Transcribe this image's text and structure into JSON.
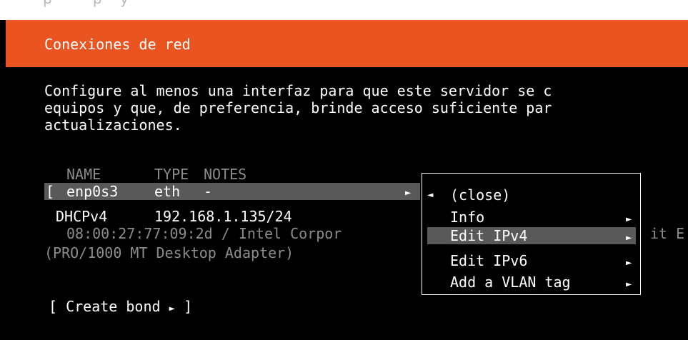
{
  "header": {
    "title": "Conexiones de red"
  },
  "description": {
    "line1": "Configure al menos una interfaz para que este servidor se c",
    "line2": "equipos y que, de preferencia, brinde acceso suficiente par",
    "line3": "actualizaciones."
  },
  "table": {
    "columns": [
      "NAME",
      "TYPE",
      "NOTES"
    ],
    "interface": {
      "bracket": "[",
      "name": "enp0s3",
      "type": "eth",
      "notes": "-",
      "arrow": "►"
    },
    "dhcp": {
      "label": "DHCPv4",
      "address": "192.168.1.135/24"
    },
    "mac_line": "08:00:27:77:09:2d / Intel Corpor",
    "mac_tail": "it E",
    "adapter_line": "(PRO/1000 MT Desktop Adapter)"
  },
  "create_bond": {
    "open": "[",
    "label": "Create bond",
    "arrow": "►",
    "close": "]"
  },
  "menu": {
    "back_arrow": "◄",
    "items": [
      {
        "label": "(close)",
        "arrow": ""
      },
      {
        "label": "Info",
        "arrow": "►"
      },
      {
        "label": "Edit IPv4",
        "arrow": "►"
      },
      {
        "label": "Edit IPv6",
        "arrow": "►"
      },
      {
        "label": "Add a VLAN tag",
        "arrow": "►"
      }
    ]
  },
  "colors": {
    "header": "#e95420",
    "background": "#000000",
    "selection": "#595959",
    "dim_text": "#8c8c8c"
  }
}
